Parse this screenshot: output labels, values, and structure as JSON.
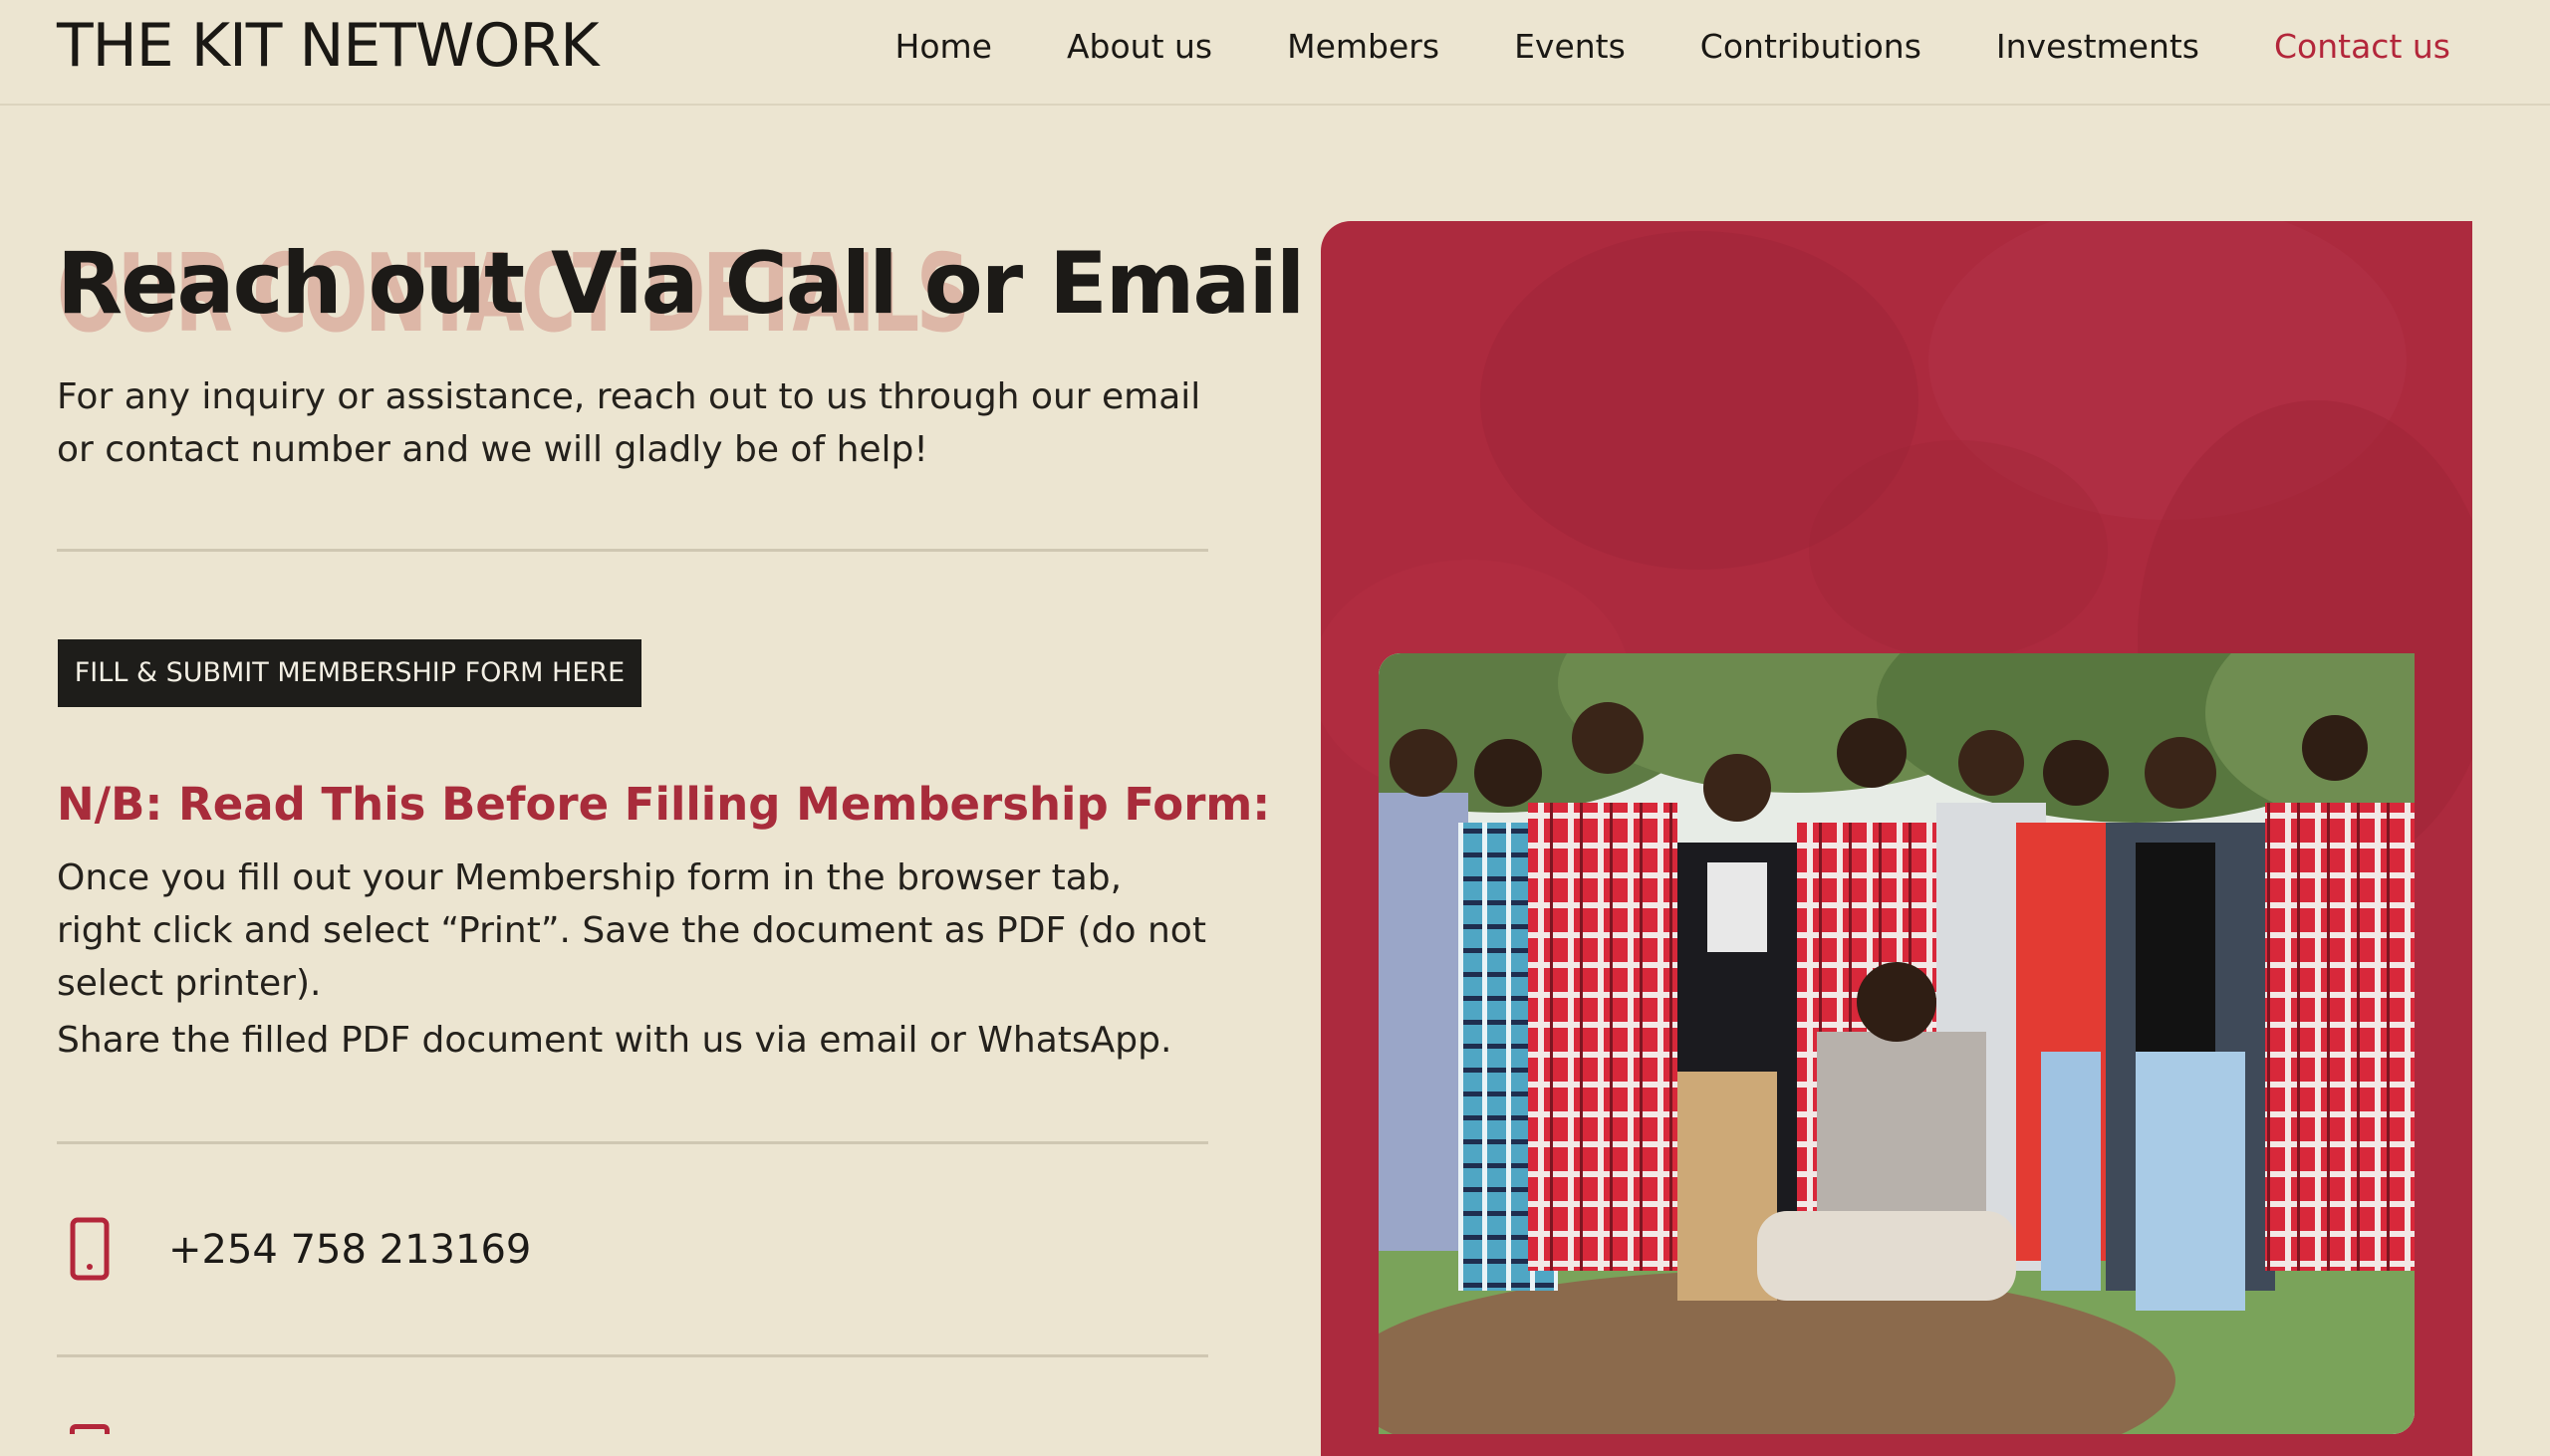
{
  "header": {
    "logo": "THE KIT NETWORK",
    "nav": [
      {
        "label": "Home"
      },
      {
        "label": "About us"
      },
      {
        "label": "Members"
      },
      {
        "label": "Events"
      },
      {
        "label": "Contributions"
      },
      {
        "label": "Investments"
      },
      {
        "label": "Contact us",
        "active": true
      }
    ]
  },
  "contact": {
    "title": "Reach out Via Call or Email",
    "title_ghost": "OUR CONTACT DETAILS",
    "intro": "For any inquiry or assistance, reach out to us through our email or contact number and we will gladly be of help!",
    "form_button": "FILL & SUBMIT MEMBERSHIP FORM HERE",
    "nb_heading": "N/B: Read This Before Filling Membership Form:",
    "nb_body": "Once you fill out your Membership form in the browser tab, right click and select “Print”. Save the document as PDF (do not select printer).",
    "nb_share": "Share the filled PDF document with us via email or WhatsApp.",
    "phone": "+254 758 213169",
    "phone_icon": "mobile-phone-icon"
  },
  "colors": {
    "background": "#ece5d1",
    "accent": "#b3263a",
    "card": "#ac2a3e",
    "button": "#1e1d1a"
  }
}
